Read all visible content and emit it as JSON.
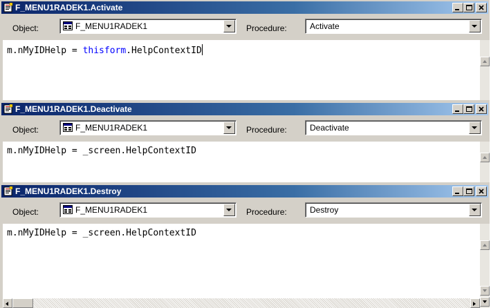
{
  "windows": [
    {
      "title": "F_MENU1RADEK1.Activate",
      "object_label": "Object:",
      "object_value": "F_MENU1RADEK1",
      "procedure_label": "Procedure:",
      "procedure_value": "Activate",
      "code": {
        "prefix": "m.nMyIDHelp = ",
        "keyword": "thisform",
        "suffix": ".HelpContextID"
      }
    },
    {
      "title": "F_MENU1RADEK1.Deactivate",
      "object_label": "Object:",
      "object_value": "F_MENU1RADEK1",
      "procedure_label": "Procedure:",
      "procedure_value": "Deactivate",
      "code": {
        "line": "m.nMyIDHelp = _screen.HelpContextID"
      }
    },
    {
      "title": "F_MENU1RADEK1.Destroy",
      "object_label": "Object:",
      "object_value": "F_MENU1RADEK1",
      "procedure_label": "Procedure:",
      "procedure_value": "Destroy",
      "code": {
        "line": "m.nMyIDHelp = _screen.HelpContextID"
      }
    }
  ],
  "icons": {
    "window": "form-code-icon",
    "object": "form-object-icon",
    "minimize": "minimize-icon",
    "maximize": "maximize-icon",
    "close": "close-icon",
    "dropdown": "chevron-down-icon"
  },
  "colors": {
    "titlebar_start": "#0a246a",
    "titlebar_end": "#a6caf0",
    "keyword": "#0000ff",
    "face": "#d4d0c8"
  }
}
